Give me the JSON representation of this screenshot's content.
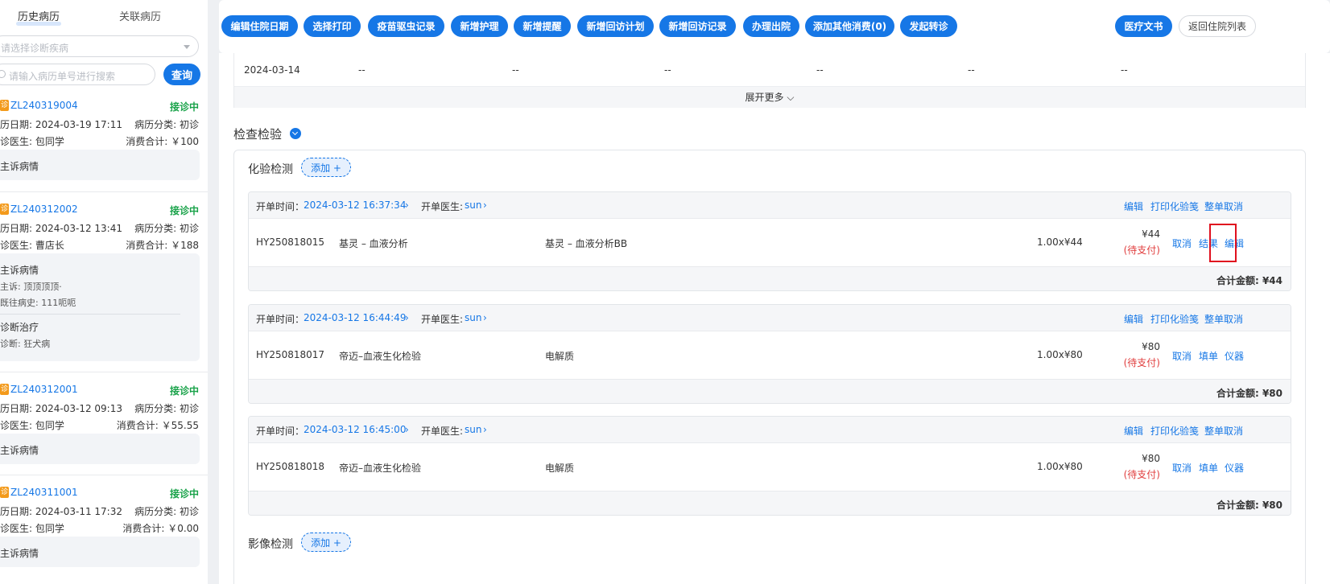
{
  "sidebar": {
    "tabs": [
      "历史病历",
      "关联病历"
    ],
    "diagnosis_placeholder": "请选择诊断疾病",
    "search_placeholder": "请输入病历单号进行搜索",
    "query_label": "查询",
    "records": [
      {
        "tag": "诊",
        "id": "ZL240319004",
        "status": "接诊中",
        "date": "历日期: 2024-03-19 17:11",
        "category": "病历分类: 初诊",
        "doctor": "诊医生: 包同学",
        "total": "消费合计: ￥100",
        "box": [
          {
            "t": "h",
            "text": "主诉病情"
          }
        ]
      },
      {
        "tag": "诊",
        "id": "ZL240312002",
        "status": "接诊中",
        "date": "历日期: 2024-03-12 13:41",
        "category": "病历分类: 初诊",
        "doctor": "诊医生: 曹店长",
        "total": "消费合计: ￥188",
        "box": [
          {
            "t": "h",
            "text": "主诉病情"
          },
          {
            "t": "s",
            "text": "主诉:  顶顶顶顶·"
          },
          {
            "t": "s",
            "text": "既往病史:  111呃呃"
          },
          {
            "t": "d"
          },
          {
            "t": "h",
            "text": "诊断治疗"
          },
          {
            "t": "s",
            "text": "诊断: 狂犬病"
          }
        ]
      },
      {
        "tag": "诊",
        "id": "ZL240312001",
        "status": "接诊中",
        "date": "历日期: 2024-03-12 09:13",
        "category": "病历分类: 初诊",
        "doctor": "诊医生: 包同学",
        "total": "消费合计: ￥55.55",
        "box": [
          {
            "t": "h",
            "text": "主诉病情"
          }
        ]
      },
      {
        "tag": "诊",
        "id": "ZL240311001",
        "status": "接诊中",
        "date": "历日期: 2024-03-11 17:32",
        "category": "病历分类: 初诊",
        "doctor": "诊医生: 包同学",
        "total": "消费合计: ￥0.00",
        "box": [
          {
            "t": "h",
            "text": "主诉病情"
          }
        ]
      }
    ]
  },
  "toolbar": {
    "buttons": [
      "编辑住院日期",
      "选择打印",
      "疫苗驱虫记录",
      "新增护理",
      "新增提醒",
      "新增回访计划",
      "新增回访记录",
      "办理出院",
      "添加其他消费(0)",
      "发起转诊"
    ],
    "medical_doc": "医疗文书",
    "back": "返回住院列表"
  },
  "prev_table": {
    "row": [
      "2024-03-14",
      "--",
      "--",
      "--",
      "--",
      "--",
      "--"
    ],
    "expand": "展开更多"
  },
  "section": {
    "title": "检查检验"
  },
  "lab": {
    "title": "化验检测",
    "add": "添加 +",
    "orders": [
      {
        "time_label": "开单时间：",
        "time": "2024-03-12 16:37:34",
        "doctor_label": "开单医生:",
        "doctor": "sun",
        "actions": [
          "编辑",
          "打印化验笺",
          "整单取消"
        ],
        "code": "HY250818015",
        "name": "基灵 – 血液分析",
        "item": "基灵 – 血液分析BB",
        "qty": "1.00x¥44",
        "price": "¥44",
        "pay": "(待支付)",
        "row_actions": [
          "取消",
          "结果",
          "编辑"
        ],
        "total": "合计金额: ¥44"
      },
      {
        "time_label": "开单时间：",
        "time": "2024-03-12 16:44:49",
        "doctor_label": "开单医生:",
        "doctor": "sun",
        "actions": [
          "编辑",
          "打印化验笺",
          "整单取消"
        ],
        "code": "HY250818017",
        "name": "帝迈–血液生化检验",
        "item": "电解质",
        "qty": "1.00x¥80",
        "price": "¥80",
        "pay": "(待支付)",
        "row_actions": [
          "取消",
          "填单",
          "仪器"
        ],
        "total": "合计金额: ¥80"
      },
      {
        "time_label": "开单时间：",
        "time": "2024-03-12 16:45:00",
        "doctor_label": "开单医生:",
        "doctor": "sun",
        "actions": [
          "编辑",
          "打印化验笺",
          "整单取消"
        ],
        "code": "HY250818018",
        "name": "帝迈–血液生化检验",
        "item": "电解质",
        "qty": "1.00x¥80",
        "price": "¥80",
        "pay": "(待支付)",
        "row_actions": [
          "取消",
          "填单",
          "仪器"
        ],
        "total": "合计金额: ¥80"
      }
    ]
  },
  "imaging": {
    "title": "影像检测",
    "add": "添加 +"
  },
  "colors": {
    "primary": "#1677e6",
    "success": "#1aa34a",
    "danger": "#e03c3c",
    "tag": "#f39a1b"
  }
}
